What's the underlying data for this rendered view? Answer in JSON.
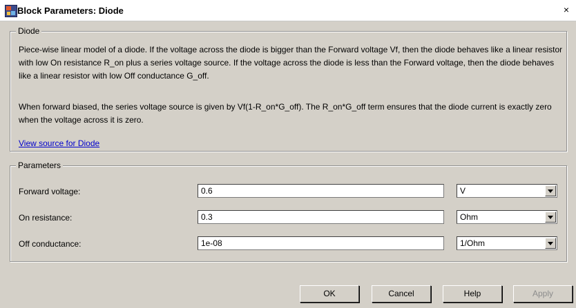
{
  "window": {
    "title": "Block Parameters: Diode",
    "close_symbol": "×",
    "icon": "simulink-block-icon"
  },
  "description": {
    "group_title": "Diode",
    "paragraph1": "Piece-wise linear model of a diode. If the voltage across the diode is bigger than the Forward voltage Vf, then the diode behaves like a linear resistor with low On resistance R_on plus a series voltage source. If the voltage across the diode is less than the Forward voltage, then the diode behaves like a linear resistor with low Off conductance G_off.",
    "paragraph2": "When forward biased, the series voltage source is given by Vf(1-R_on*G_off). The R_on*G_off term ensures that the diode current is exactly zero when the voltage across it is zero.",
    "link_text": "View source for Diode"
  },
  "parameters": {
    "group_title": "Parameters",
    "rows": [
      {
        "label": "Forward voltage:",
        "value": "0.6",
        "unit": "V"
      },
      {
        "label": "On resistance:",
        "value": "0.3",
        "unit": "Ohm"
      },
      {
        "label": "Off conductance:",
        "value": "1e-08",
        "unit": "1/Ohm"
      }
    ]
  },
  "buttons": {
    "ok": "OK",
    "cancel": "Cancel",
    "help": "Help",
    "apply": "Apply"
  }
}
